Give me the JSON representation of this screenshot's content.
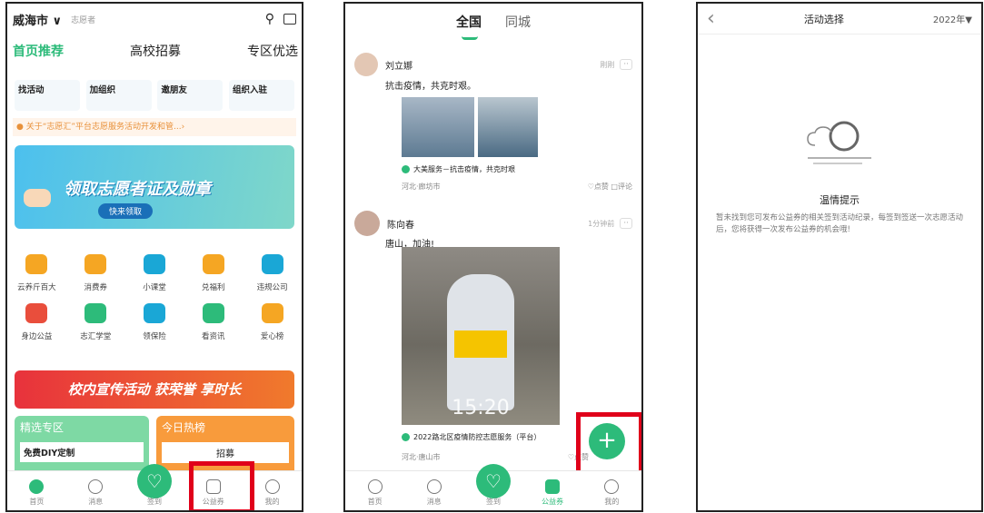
{
  "p1": {
    "top": {
      "city": "威海市 ∨",
      "user": "志愿者"
    },
    "tabs": [
      "首页推荐",
      "高校招募",
      "专区优选"
    ],
    "quick": [
      {
        "label": "找活动"
      },
      {
        "label": "加组织"
      },
      {
        "label": "邀朋友"
      },
      {
        "label": "组织入驻"
      }
    ],
    "notice": "● 关于“志愿汇”平台志愿服务活动开发和管...›",
    "banner": {
      "title": "领取志愿者证及勋章",
      "btn": "快来领取"
    },
    "grid": [
      {
        "label": "云养斤百大",
        "color": "#f5a623"
      },
      {
        "label": "消费券",
        "color": "#f5a623"
      },
      {
        "label": "小课堂",
        "color": "#1aa7d6"
      },
      {
        "label": "兑福利",
        "color": "#f5a623"
      },
      {
        "label": "违规公司",
        "color": "#1aa7d6"
      },
      {
        "label": "身边公益",
        "color": "#e94e3c"
      },
      {
        "label": "志汇学堂",
        "color": "#2dbb7a"
      },
      {
        "label": "领保险",
        "color": "#1aa7d6"
      },
      {
        "label": "看资讯",
        "color": "#2dbb7a"
      },
      {
        "label": "爱心榜",
        "color": "#f5a623"
      }
    ],
    "promo": "校内宣传活动 获荣誉 享时长",
    "cards": {
      "left_title": "精选专区",
      "left_sub": "免费DIY定制",
      "right_title": "今日热榜",
      "right_sub": "招募"
    },
    "nav": [
      "首页",
      "消息",
      "签到",
      "公益券",
      "我的"
    ]
  },
  "p2": {
    "tabs": [
      "全国",
      "同城"
    ],
    "posts": [
      {
        "name": "刘立娜",
        "time": "刚刚",
        "text": "抗击疫情，共克时艰。",
        "topic": "大美服务－抗击疫情，共克时艰",
        "loc": "河北·廊坊市",
        "actions": "♡点赞  □评论"
      },
      {
        "name": "陈向春",
        "time": "1分钟前",
        "text": "唐山，加油!",
        "topic": "2022路北区疫情防控志愿服务（平台）",
        "loc": "河北·唐山市",
        "actions": "♡点赞",
        "overlay": "15:20"
      }
    ],
    "more": "··",
    "nav": [
      "首页",
      "消息",
      "签到",
      "公益券",
      "我的"
    ],
    "fab": "+"
  },
  "p3": {
    "back": "‹",
    "title": "活动选择",
    "year": "2022年▼",
    "tip_title": "温情提示",
    "tip_text": "暂未找到您可发布公益券的相关签到活动纪录，每签到签送一次志愿活动后，您将获得一次发布公益券的机会哦!"
  }
}
